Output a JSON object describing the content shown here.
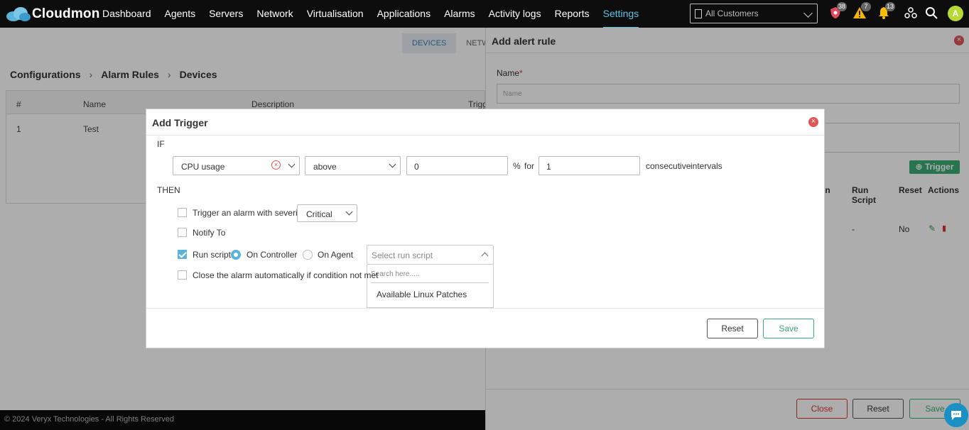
{
  "brand": {
    "name": "Cloudmon"
  },
  "nav": {
    "items": [
      "Dashboard",
      "Agents",
      "Servers",
      "Network",
      "Virtualisation",
      "Applications",
      "Alarms",
      "Activity logs",
      "Reports",
      "Settings"
    ],
    "active": "Settings",
    "customer_select": "All Customers",
    "badges": {
      "security": "38",
      "warning": "7",
      "notifications": "13"
    },
    "avatar": "A"
  },
  "background_page": {
    "tabs": [
      "DEVICES",
      "NETW"
    ],
    "breadcrumb": [
      "Configurations",
      "Alarm Rules",
      "Devices"
    ],
    "table": {
      "headers": [
        "#",
        "Name",
        "Description",
        "Trigg"
      ],
      "rows": [
        [
          "1",
          "Test"
        ]
      ]
    },
    "footer": "© 2024 Veryx Technologies - All Rights Reserved"
  },
  "drawer": {
    "title": "Add alert rule",
    "name_label": "Name",
    "name_placeholder": "Name",
    "trigger_button": "Trigger",
    "table_headers": {
      "condition_partial": "on",
      "run_script": "Run Script",
      "reset": "Reset",
      "actions": "Actions"
    },
    "row": {
      "run_script": "-",
      "reset": "No"
    },
    "buttons": {
      "close": "Close",
      "reset": "Reset",
      "save": "Save"
    }
  },
  "modal": {
    "title": "Add Trigger",
    "if_label": "IF",
    "then_label": "THEN",
    "metric": "CPU usage",
    "comparator": "above",
    "threshold": "0",
    "unit": "%",
    "for_label": "for",
    "intervals_value": "1",
    "consecutive_label": "consecutive",
    "intervals_label": "intervals",
    "actions": {
      "trigger_alarm": {
        "label": "Trigger an alarm with severity",
        "checked": false,
        "severity": "Critical"
      },
      "notify": {
        "label": "Notify To",
        "checked": false
      },
      "run_script": {
        "label": "Run script",
        "checked": true,
        "on_controller": "On Controller",
        "on_agent": "On Agent",
        "selected": "On Controller",
        "placeholder": "Select run script",
        "search_placeholder": "Search here.....",
        "options": [
          "Available Linux Patches"
        ]
      },
      "auto_close": {
        "label": "Close the alarm automatically if condition not met",
        "checked": false
      }
    },
    "buttons": {
      "reset": "Reset",
      "save": "Save"
    }
  },
  "colors": {
    "accent": "#5ab4d9",
    "success": "#3bab74",
    "danger": "#e05555",
    "nav_bg": "#0d0d0d",
    "nav_active": "#5fc3e4"
  }
}
